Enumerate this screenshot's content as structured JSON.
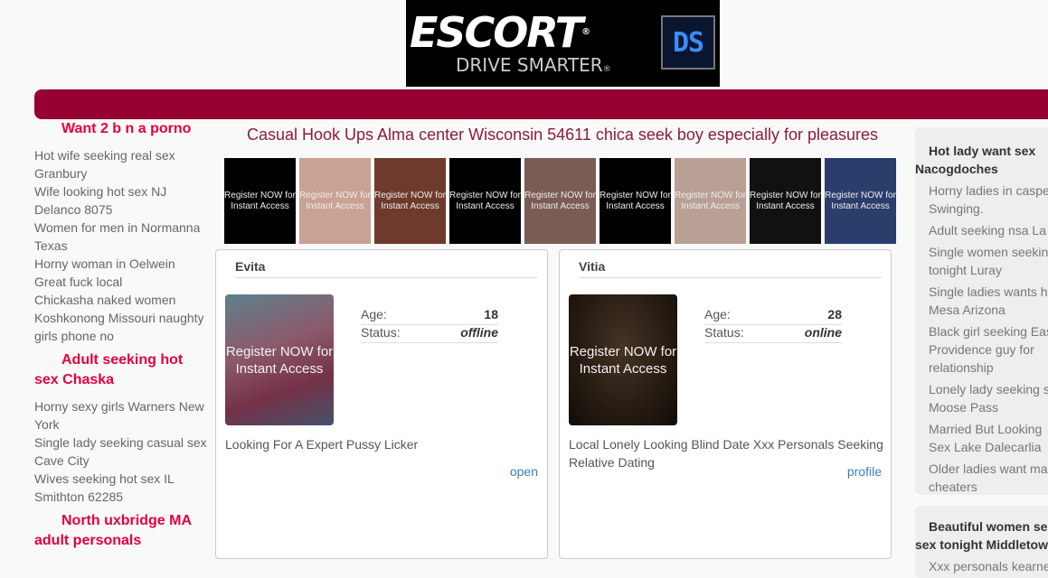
{
  "banner": {
    "brand": "ESCORT",
    "reg": "®",
    "tagline": "DRIVE SMARTER",
    "tagline_reg": "®",
    "badge": "DS"
  },
  "left": {
    "sections": [
      {
        "heading": "Want 2 b n a porno",
        "links": [
          "Hot wife seeking real sex Granbury",
          "Wife looking hot sex NJ Delanco 8075",
          "Women for men in Normanna Texas",
          "Horny woman in Oelwein",
          "Great fuck local",
          "Chickasha naked women",
          "Koshkonong Missouri naughty girls phone no"
        ]
      },
      {
        "heading": "Adult seeking hot sex Chaska",
        "links": [
          "Horny sexy girls Warners New York",
          "Single lady seeking casual sex Cave City",
          "Wives seeking hot sex IL Smithton 62285"
        ]
      },
      {
        "heading": "North uxbridge MA adult personals",
        "links": []
      }
    ]
  },
  "main": {
    "title": "Casual Hook Ups Alma center Wisconsin 54611 chica seek boy especially for pleasures",
    "thumb_text": "Register NOW for Instant Access",
    "thumbs": [
      {
        "bg": "#000000"
      },
      {
        "bg": "#c9a294"
      },
      {
        "bg": "#6d3a2c"
      },
      {
        "bg": "#000000"
      },
      {
        "bg": "#7a5c55"
      },
      {
        "bg": "#000000"
      },
      {
        "bg": "#b8a095"
      },
      {
        "bg": "#111111"
      },
      {
        "bg": "#2b3d6b"
      }
    ],
    "cards": [
      {
        "name": "Evita",
        "photo_text": "Register NOW for Instant Access",
        "age_label": "Age:",
        "age": "18",
        "status_label": "Status:",
        "status": "offline",
        "description": "Looking For A Expert Pussy Licker",
        "link": "open"
      },
      {
        "name": "Vitia",
        "photo_text": "Register NOW for Instant Access",
        "age_label": "Age:",
        "age": "28",
        "status_label": "Status:",
        "status": "online",
        "description": "Local Lonely Looking Blind Date Xxx Personals Seeking Relative Dating",
        "link": "profile"
      }
    ]
  },
  "right": {
    "boxes": [
      {
        "heading_1": "Hot lady want sex",
        "heading_2": "Nacogdoches",
        "links": [
          [
            "Horny ladies in caspe",
            "Swinging."
          ],
          [
            "Adult seeking nsa La"
          ],
          [
            "Single women seekin",
            "tonight Luray"
          ],
          [
            "Single ladies wants h",
            "Mesa Arizona"
          ],
          [
            "Black girl seeking Eas",
            "Providence guy for",
            "relationship"
          ],
          [
            "Lonely lady seeking s",
            "Moose Pass"
          ],
          [
            "Married But Looking",
            "Sex Lake Dalecarlia"
          ],
          [
            "Older ladies want ma",
            "cheaters"
          ]
        ]
      },
      {
        "heading_1": "Beautiful women se",
        "heading_2": "sex tonight Middletow",
        "links": [
          [
            "Xxx personals kearne"
          ]
        ]
      }
    ]
  }
}
